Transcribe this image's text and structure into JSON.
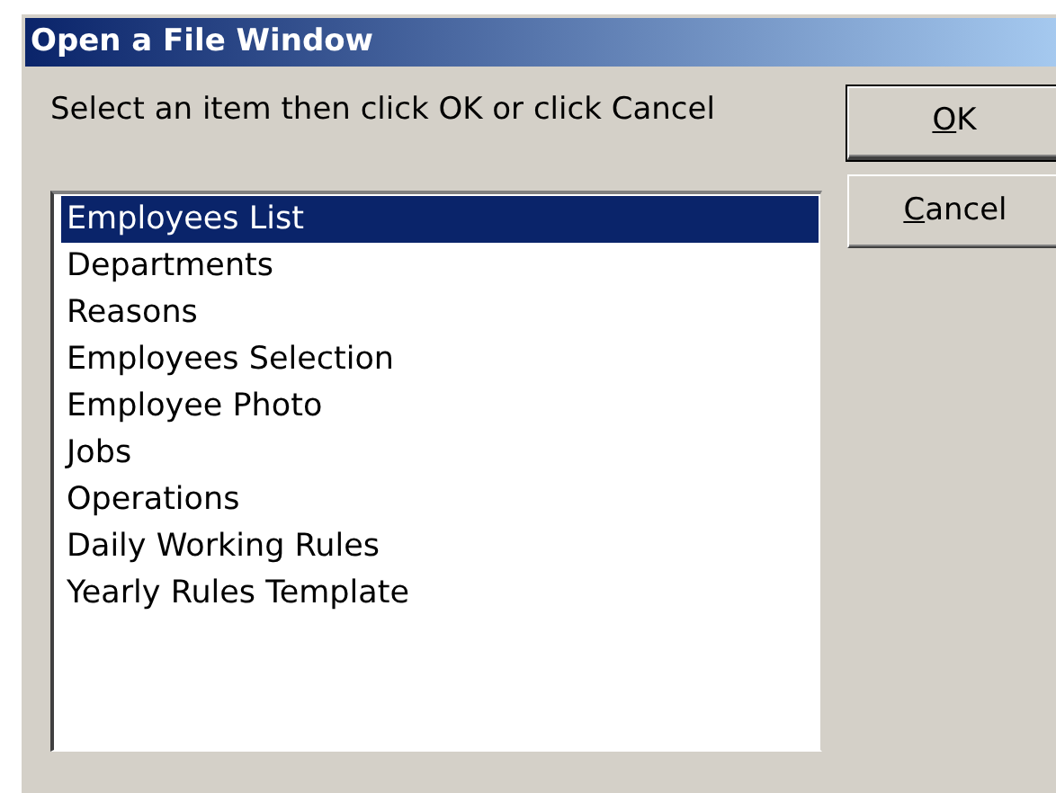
{
  "window": {
    "title": "Open a File Window"
  },
  "prompt": "Select an item then click OK or click Cancel",
  "buttons": [
    {
      "label": "OK",
      "underline_first": true,
      "default": true
    },
    {
      "label": "Cancel",
      "underline_first": true,
      "default": false
    }
  ],
  "list": [
    {
      "label": "Employees List",
      "selected": true
    },
    {
      "label": "Departments",
      "selected": false
    },
    {
      "label": "Reasons",
      "selected": false
    },
    {
      "label": "Employees Selection",
      "selected": false
    },
    {
      "label": "Employee Photo",
      "selected": false
    },
    {
      "label": "Jobs",
      "selected": false
    },
    {
      "label": "Operations",
      "selected": false
    },
    {
      "label": "Daily Working Rules",
      "selected": false
    },
    {
      "label": "Yearly Rules Template",
      "selected": false
    }
  ]
}
